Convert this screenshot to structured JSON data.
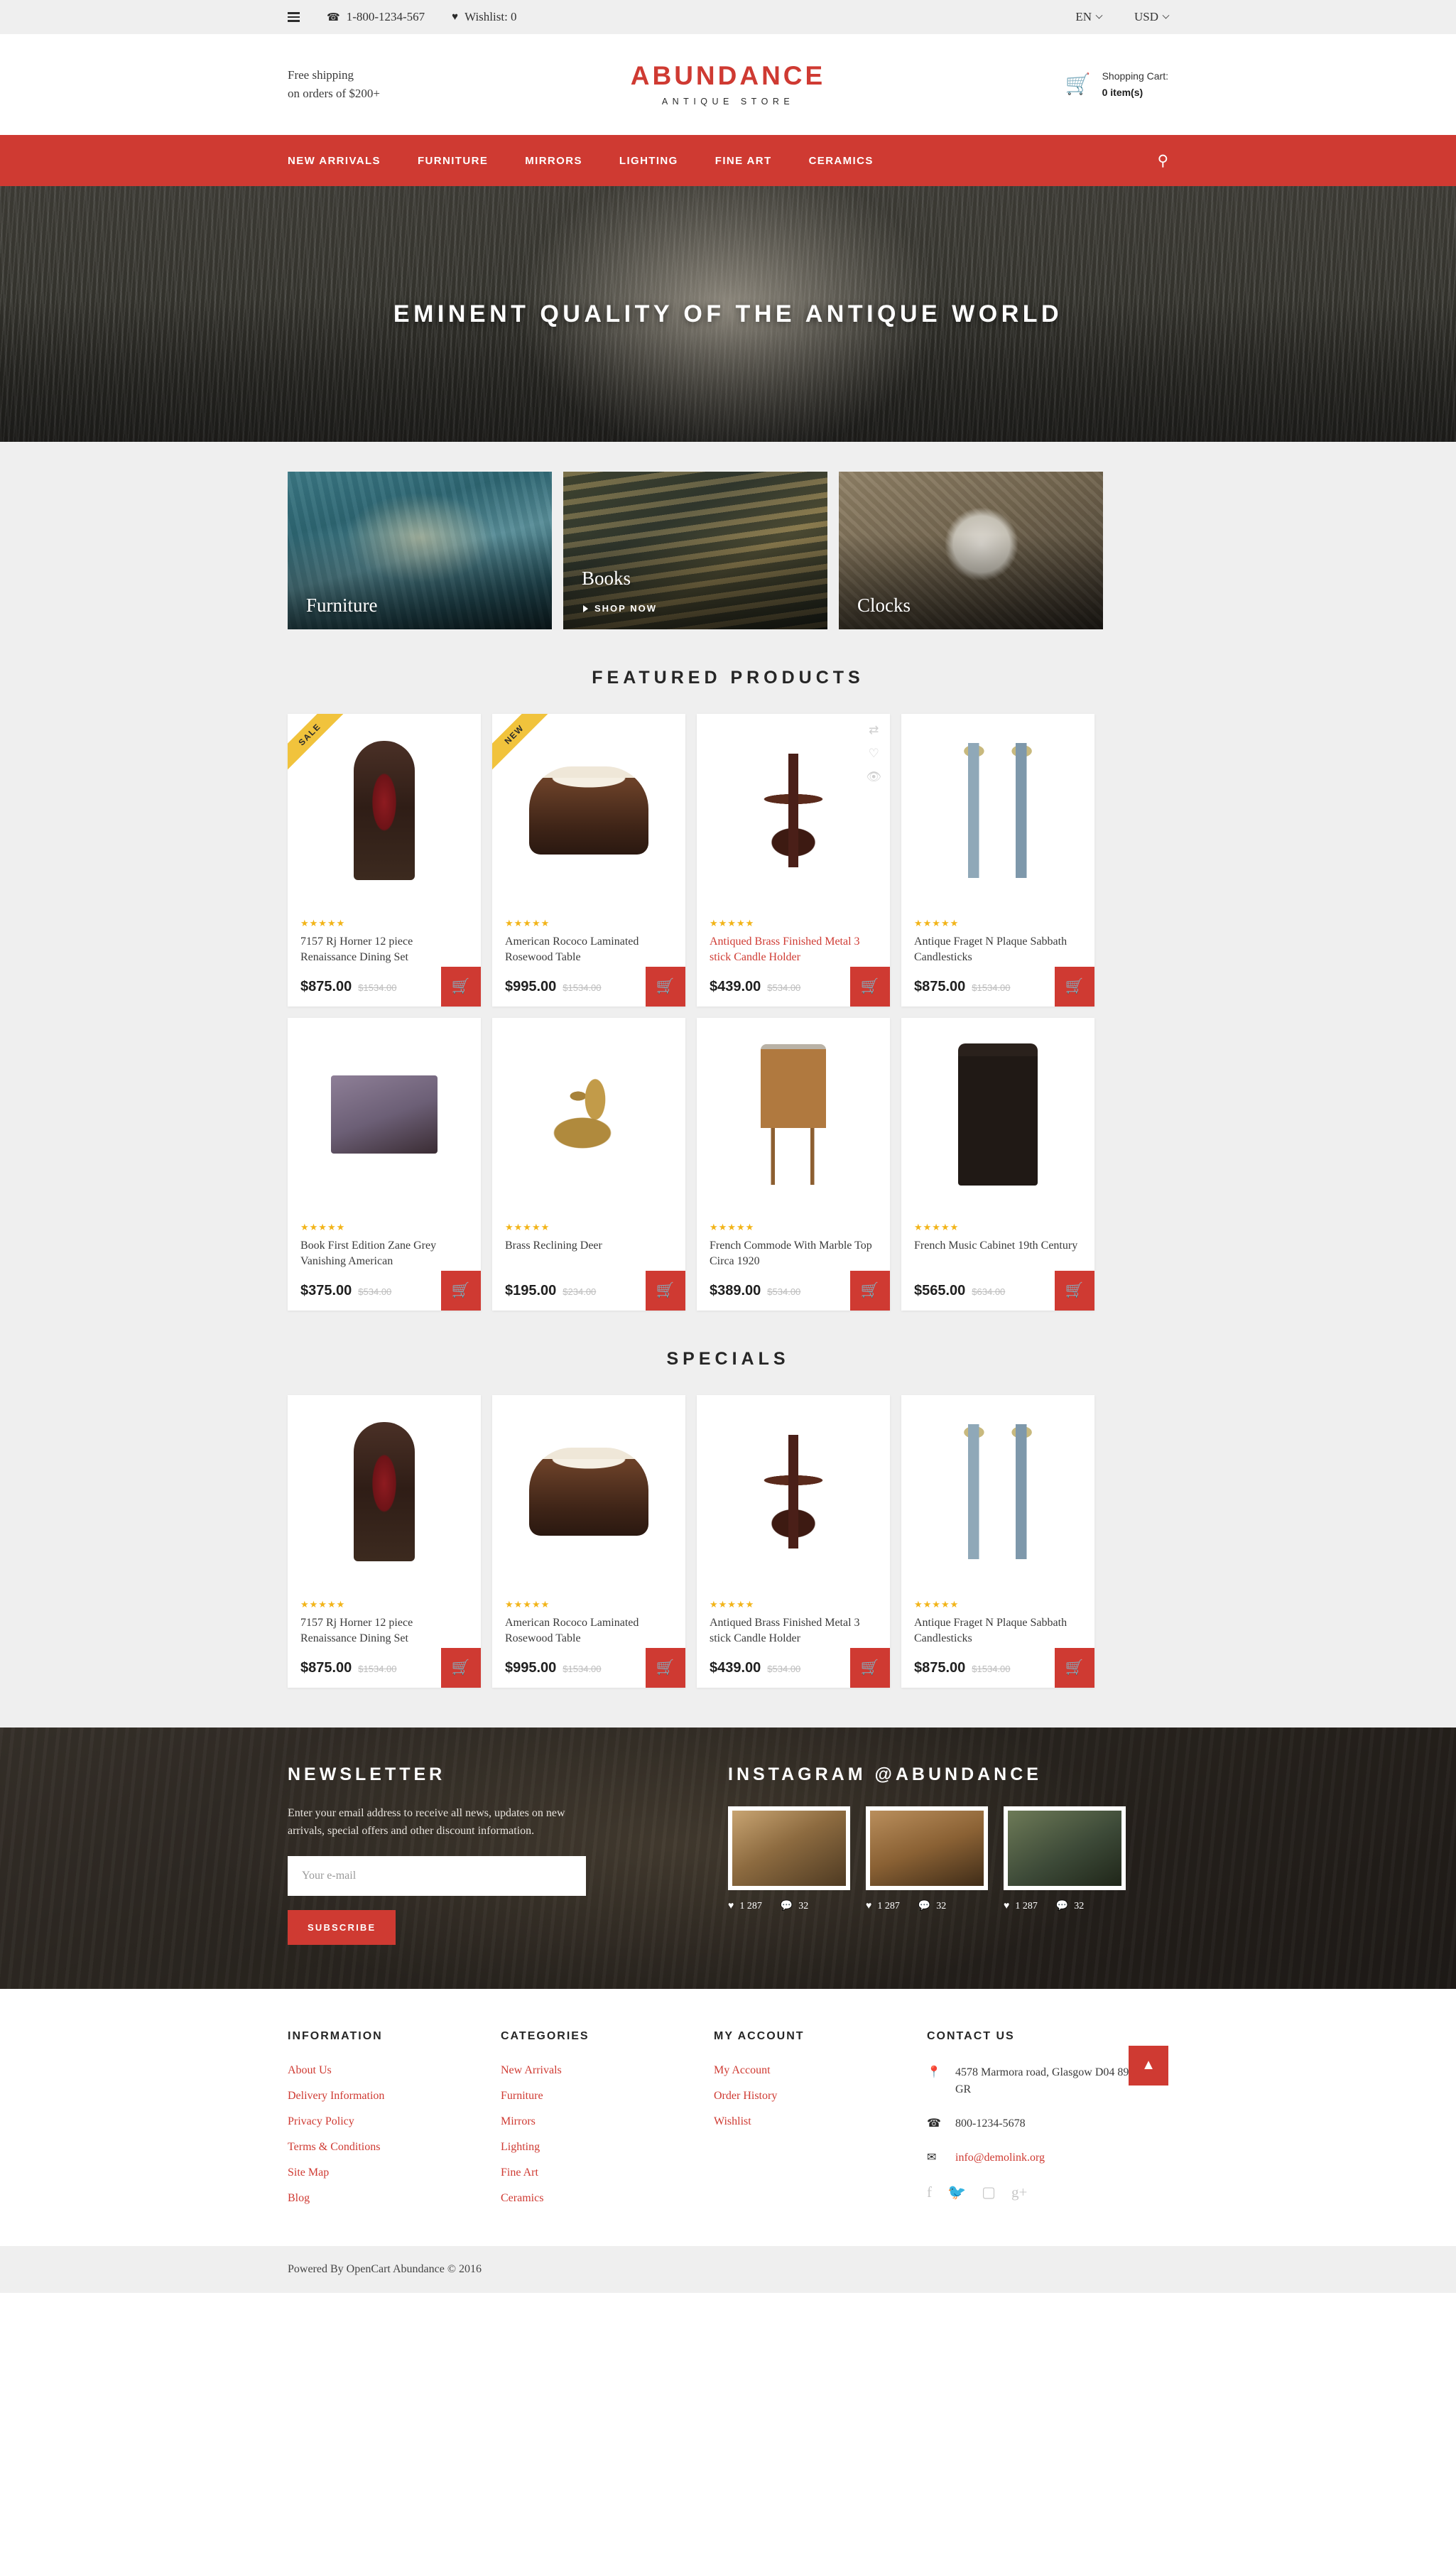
{
  "topbar": {
    "menu_icon": "hamburger-icon",
    "phone_icon": "phone-icon",
    "phone": "1-800-1234-567",
    "wishlist_icon": "heart-icon",
    "wishlist": "Wishlist: 0",
    "language": "EN",
    "currency": "USD"
  },
  "header": {
    "shipping_line1": "Free shipping",
    "shipping_line2": "on orders of $200+",
    "logo_main": "ABUNDANCE",
    "logo_sub": "ANTIQUE STORE",
    "cart_icon": "shopping-cart-icon",
    "cart_label": "Shopping Cart:",
    "cart_count": "0 item(s)"
  },
  "nav": {
    "items": [
      {
        "label": "NEW ARRIVALS"
      },
      {
        "label": "FURNITURE"
      },
      {
        "label": "MIRRORS"
      },
      {
        "label": "LIGHTING"
      },
      {
        "label": "FINE ART"
      },
      {
        "label": "CERAMICS"
      }
    ],
    "search_icon": "search-icon"
  },
  "hero": {
    "title": "EMINENT QUALITY OF THE ANTIQUE WORLD"
  },
  "categories": [
    {
      "label": "Furniture",
      "cta": ""
    },
    {
      "label": "Books",
      "cta": "SHOP NOW"
    },
    {
      "label": "Clocks",
      "cta": ""
    }
  ],
  "featured": {
    "title": "FEATURED PRODUCTS",
    "products": [
      {
        "name": "7157 Rj Horner 12 piece Renaissance Dining Set",
        "price": "$875.00",
        "old_price": "$1534.00",
        "stars": "★★★★★",
        "badge": "SALE",
        "art": "art-chair",
        "highlight": false
      },
      {
        "name": "American Rococo Laminated Rosewood Table",
        "price": "$995.00",
        "old_price": "$1534.00",
        "stars": "★★★★★",
        "badge": "NEW",
        "art": "art-table",
        "highlight": false
      },
      {
        "name": "Antiqued Brass Finished Metal 3 stick Candle Holder",
        "price": "$439.00",
        "old_price": "$534.00",
        "stars": "★★★★★",
        "badge": "",
        "art": "art-cand",
        "highlight": true
      },
      {
        "name": "Antique Fraget N Plaque Sabbath Candlesticks",
        "price": "$875.00",
        "old_price": "$1534.00",
        "stars": "★★★★★",
        "badge": "",
        "art": "art-sticks",
        "highlight": false
      },
      {
        "name": "Book First Edition Zane Grey Vanishing American",
        "price": "$375.00",
        "old_price": "$534.00",
        "stars": "★★★★★",
        "badge": "",
        "art": "art-book",
        "highlight": false
      },
      {
        "name": "Brass Reclining Deer",
        "price": "$195.00",
        "old_price": "$234.00",
        "stars": "★★★★★",
        "badge": "",
        "art": "art-deer",
        "highlight": false
      },
      {
        "name": "French Commode With Marble Top Circa 1920",
        "price": "$389.00",
        "old_price": "$534.00",
        "stars": "★★★★★",
        "badge": "",
        "art": "art-commode",
        "highlight": false
      },
      {
        "name": "French Music Cabinet 19th Century",
        "price": "$565.00",
        "old_price": "$634.00",
        "stars": "★★★★★",
        "badge": "",
        "art": "art-cabinet",
        "highlight": false
      }
    ]
  },
  "specials": {
    "title": "SPECIALS",
    "products": [
      {
        "name": "7157 Rj Horner 12 piece Renaissance Dining Set",
        "price": "$875.00",
        "old_price": "$1534.00",
        "stars": "★★★★★",
        "badge": "",
        "art": "art-chair",
        "highlight": false
      },
      {
        "name": "American Rococo Laminated Rosewood Table",
        "price": "$995.00",
        "old_price": "$1534.00",
        "stars": "★★★★★",
        "badge": "",
        "art": "art-table",
        "highlight": false
      },
      {
        "name": "Antiqued Brass Finished Metal 3 stick Candle Holder",
        "price": "$439.00",
        "old_price": "$534.00",
        "stars": "★★★★★",
        "badge": "",
        "art": "art-cand",
        "highlight": false
      },
      {
        "name": "Antique Fraget N Plaque Sabbath Candlesticks",
        "price": "$875.00",
        "old_price": "$1534.00",
        "stars": "★★★★★",
        "badge": "",
        "art": "art-sticks",
        "highlight": false
      }
    ]
  },
  "product_actions": {
    "compare_icon": "compare-arrows-icon",
    "wishlist_icon": "heart-outline-icon",
    "quickview_icon": "eye-icon",
    "cart_icon": "shopping-cart-icon"
  },
  "newsletter": {
    "title": "NEWSLETTER",
    "text": "Enter your email address to receive all news, updates on new arrivals, special offers and other discount information.",
    "placeholder": "Your e-mail",
    "button": "SUBSCRIBE"
  },
  "instagram": {
    "title": "INSTAGRAM @ABUNDANCE",
    "posts": [
      {
        "likes": "1 287",
        "comments": "32"
      },
      {
        "likes": "1 287",
        "comments": "32"
      },
      {
        "likes": "1 287",
        "comments": "32"
      }
    ]
  },
  "footer": {
    "information": {
      "title": "INFORMATION",
      "links": [
        "About Us",
        "Delivery Information",
        "Privacy Policy",
        "Terms & Conditions",
        "Site Map",
        "Blog"
      ]
    },
    "categories": {
      "title": "CATEGORIES",
      "links": [
        "New Arrivals",
        "Furniture",
        "Mirrors",
        "Lighting",
        "Fine Art",
        "Ceramics"
      ]
    },
    "account": {
      "title": "MY ACCOUNT",
      "links": [
        "My Account",
        "Order History",
        "Wishlist"
      ]
    },
    "contact": {
      "title": "CONTACT US",
      "address": "4578 Marmora road, Glasgow D04 89 GR",
      "phone": "800-1234-5678",
      "email": "info@demolink.org",
      "socials": [
        "facebook-icon",
        "twitter-icon",
        "instagram-icon",
        "google-plus-icon"
      ]
    },
    "to_top_icon": "chevron-up-icon"
  },
  "copyright": "Powered By OpenCart Abundance © 2016",
  "colors": {
    "accent": "#cf3a32",
    "badge": "#f1c33c",
    "star": "#f2b419"
  }
}
